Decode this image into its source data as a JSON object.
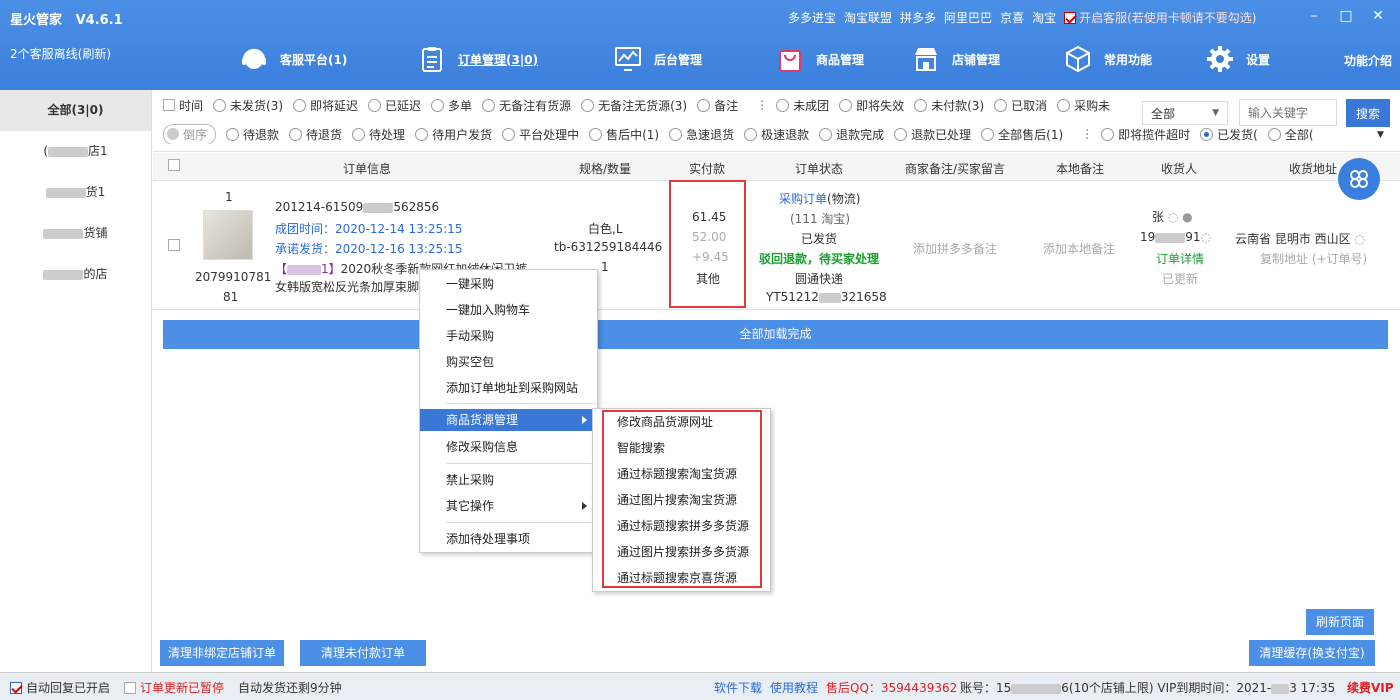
{
  "app": {
    "name": "星火管家",
    "version": "V4.6.1",
    "kefu_status": "2个客服离线(刷新)"
  },
  "top_links": [
    "多多进宝",
    "淘宝联盟",
    "拼多多",
    "阿里巴巴",
    "京喜",
    "淘宝"
  ],
  "kefu_toggle": {
    "label": "开启客服(若使用卡顿请不要勾选)",
    "checked": true
  },
  "window_buttons": {
    "minimize": "–",
    "maximize": "□",
    "close": "✕"
  },
  "nav": [
    {
      "label": "客服平台(1)",
      "icon": "headset-icon"
    },
    {
      "label": "订单管理(3|0)",
      "icon": "clipboard-icon"
    },
    {
      "label": "后台管理",
      "icon": "monitor-chart-icon"
    },
    {
      "label": "商品管理",
      "icon": "shopping-bag-icon"
    },
    {
      "label": "店铺管理",
      "icon": "store-icon"
    },
    {
      "label": "常用功能",
      "icon": "cube-icon"
    },
    {
      "label": "设置",
      "icon": "gear-icon"
    }
  ],
  "nav_right": "功能介绍",
  "sidebar": {
    "items": [
      {
        "label": "全部(3|0)",
        "active": true,
        "prefix": "",
        "suffix": ""
      },
      {
        "label": "店1",
        "prefix": "(",
        "suffix": ""
      },
      {
        "label": "货1",
        "prefix": "",
        "suffix": ""
      },
      {
        "label": "货铺",
        "prefix": "",
        "suffix": ""
      },
      {
        "label": "的店",
        "prefix": "",
        "suffix": ""
      }
    ]
  },
  "filters": {
    "row1": [
      "未发货(3)",
      "即将延迟",
      "已延迟",
      "多单",
      "无备注有货源",
      "无备注无货源(3)",
      "备注"
    ],
    "row1_b": [
      "未成团",
      "即将失效",
      "未付款(3)",
      "已取消",
      "采购未"
    ],
    "row1_time": "时间",
    "row2_toggle": "倒序",
    "row2": [
      "待退款",
      "待退货",
      "待处理",
      "待用户发货",
      "平台处理中",
      "售后中(1)",
      "急速退货",
      "极速退款",
      "退款完成",
      "退款已处理",
      "全部售后(1)"
    ],
    "row2_b": [
      "即将揽件超时",
      "已发货(",
      "全部("
    ],
    "select_value": "全部",
    "search_placeholder": "输入关键字",
    "search_label": "搜索"
  },
  "table_headers": [
    "订单信息",
    "规格/数量",
    "实付款",
    "订单状态",
    "商家备注/买家留言",
    "本地备注",
    "收货人",
    "收货地址"
  ],
  "order": {
    "qty_top": "1",
    "goods_id_1": "2079910781",
    "goods_id_2": "81",
    "order_no": "201214-61509",
    "order_no_tail": "562856",
    "group_time": "成团时间：2020-12-14 13:25:15",
    "promise_time": "承诺发货：2020-12-16 13:25:15",
    "title_tag": "【",
    "title_tag_end": "1】",
    "title": "2020秋冬季新款网红加绒休闲卫裤",
    "title_2": "女韩版宽松反光条加厚束脚",
    "spec": "白色,L",
    "sku": "tb-631259184446",
    "count": "1",
    "pay": "61.45",
    "pay_orig": "52.00",
    "pay_diff": "+9.45",
    "pay_other": "其他",
    "status_link": "采购订单",
    "status_logistics": "(物流)",
    "status_source": "(111 淘宝)",
    "status_shipped": "已发货",
    "status_refund": "驳回退款，待买家处理",
    "express": "圆通快递",
    "tracking": "YT51212",
    "tracking_tail": "321658",
    "add_merchant_note": "添加拼多多备注",
    "add_local_note": "添加本地备注",
    "receiver": "张",
    "phone_head": "19",
    "phone_tail": "91",
    "order_detail": "订单详情",
    "updated": "已更新",
    "address": "云南省 昆明市 西山区",
    "copy_address": "复制地址 (+订单号)"
  },
  "loaded_label": "全部加载完成",
  "context_menu": [
    "一键采购",
    "一键加入购物车",
    "手动采购",
    "购买空包",
    "添加订单地址到采购网站",
    "商品货源管理",
    "修改采购信息",
    "禁止采购",
    "其它操作",
    "添加待处理事项"
  ],
  "submenu": [
    "修改商品货源网址",
    "智能搜索",
    "通过标题搜索淘宝货源",
    "通过图片搜索淘宝货源",
    "通过标题搜索拼多多货源",
    "通过图片搜索拼多多货源",
    "通过标题搜索京喜货源"
  ],
  "buttons": {
    "refresh": "刷新页面",
    "clear_unbound": "清理非绑定店铺订单",
    "clear_unpaid": "清理未付款订单",
    "clear_cache": "清理缓存(换支付宝)"
  },
  "status_bar": {
    "auto_reply": "自动回复已开启",
    "update_paused": "订单更新已暂停",
    "auto_ship": "自动发货还剩9分钟",
    "download": "软件下载",
    "tutorial": "使用教程",
    "qq": "售后QQ：3594439362",
    "account": "账号：15",
    "account_tail": "6(10个店铺上限) VIP到期时间：2021-",
    "expire_tail": "3 17:35",
    "renew": "续费VIP"
  }
}
